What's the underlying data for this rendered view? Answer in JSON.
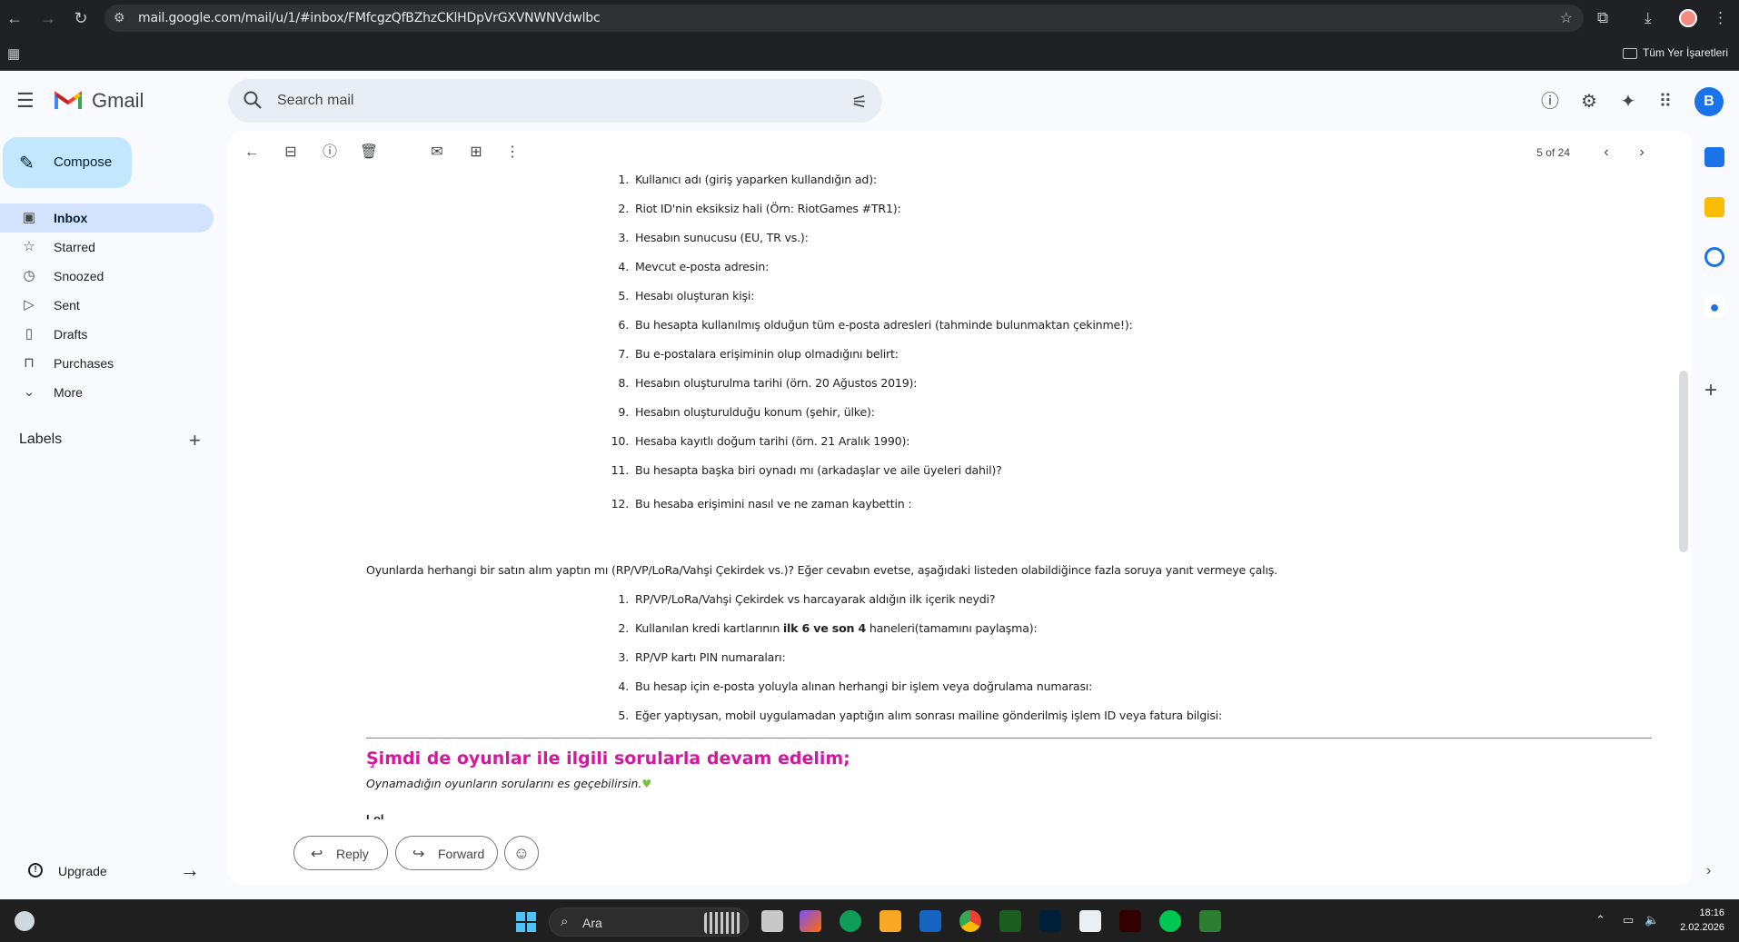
{
  "browser": {
    "url": "mail.google.com/mail/u/1/#inbox/FMfcgzQfBZhzCKlHDpVrGXVNWNVdwlbc",
    "bookmark_all": "Tüm Yer İşaretleri"
  },
  "gmail": {
    "brand": "Gmail",
    "search_placeholder": "Search mail",
    "avatar_letter": "B",
    "compose": "Compose",
    "sidebar": [
      {
        "label": "Inbox",
        "icon": "inbox-icon",
        "active": true
      },
      {
        "label": "Starred",
        "icon": "star-icon"
      },
      {
        "label": "Snoozed",
        "icon": "clock-icon"
      },
      {
        "label": "Sent",
        "icon": "send-icon"
      },
      {
        "label": "Drafts",
        "icon": "draft-icon"
      },
      {
        "label": "Purchases",
        "icon": "bag-icon"
      },
      {
        "label": "More",
        "icon": "chevron-down-icon"
      }
    ],
    "labels_heading": "Labels",
    "upgrade": "Upgrade",
    "pager": "5 of 24"
  },
  "email": {
    "list1": [
      "Kullanıcı adı (giriş yaparken kullandığın ad):",
      "Riot ID'nin eksiksiz hali (Örn: RiotGames #TR1):",
      "Hesabın sunucusu (EU, TR vs.):",
      "Mevcut e-posta adresin:",
      "Hesabı oluşturan kişi:",
      "Bu hesapta kullanılmış olduğun tüm e-posta adresleri (tahminde bulunmaktan çekinme!):",
      "Bu e-postalara erişiminin olup olmadığını belirt:",
      "Hesabın oluşturulma tarihi (örn. 20 Ağustos 2019):",
      "Hesabın oluşturulduğu konum (şehir, ülke):",
      "Hesaba kayıtlı doğum tarihi (örn. 21 Aralık 1990):",
      "Bu hesapta başka biri oynadı mı (arkadaşlar ve aile üyeleri dahil)?",
      "Bu hesaba erişimini nasıl ve ne zaman kaybettin :"
    ],
    "purchase_question": "Oyunlarda herhangi bir satın alım yaptın mı (RP/VP/LoRa/Vahşi Çekirdek vs.)? Eğer cevabın evetse, aşağıdaki listeden olabildiğince fazla soruya yanıt vermeye çalış.",
    "list2": [
      "RP/VP/LoRa/Vahşi Çekirdek vs harcayarak aldığın ilk içerik neydi?",
      "Kullanılan kredi kartlarının ",
      "RP/VP kartı PIN numaraları:",
      "Bu hesap için e-posta yoluyla alınan herhangi bir işlem veya doğrulama numarası:",
      "Eğer yaptıysan, mobil uygulamadan yaptığın alım sonrası mailine gönderilmiş işlem ID veya fatura bilgisi:"
    ],
    "list2_item2_bold": "ilk 6 ve son 4",
    "list2_item2_rest": " haneleri(tamamını paylaşma):",
    "section_heading": "Şimdi de oyunlar ile ilgili sorularla devam edelim;",
    "section_note": "Oynamadığın oyunların sorularını es geçebilirsin.",
    "next_label": "Lol"
  },
  "actions": {
    "reply": "Reply",
    "forward": "Forward"
  },
  "taskbar": {
    "search": "Ara",
    "time": "18:16",
    "date": "2.02.2026"
  },
  "colors": {
    "accent_pink": "#d4189e",
    "compose_bg": "#c2e7ff",
    "active_item_bg": "#d3e3fd"
  }
}
